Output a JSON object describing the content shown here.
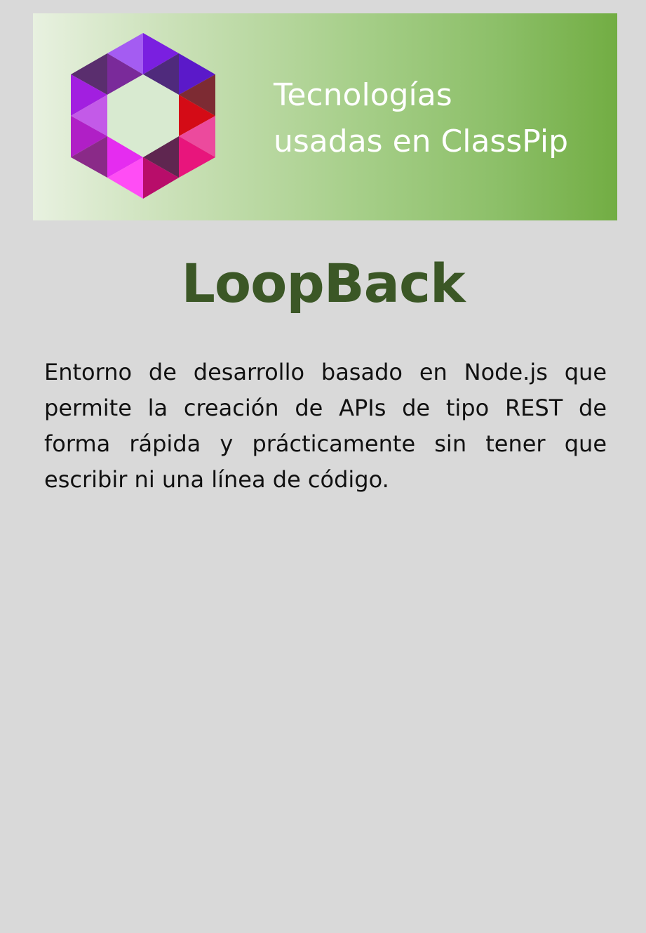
{
  "banner": {
    "title_line1": "Tecnologías",
    "title_line2": "usadas en ClassPip",
    "logo": "hexagon-logo-icon"
  },
  "main": {
    "title": "LoopBack",
    "description": "Entorno de desarrollo basado en Node.js que permite la creación de APIs de tipo REST de forma rápida y prácticamente sin tener que escribir ni una línea de código."
  },
  "colors": {
    "background": "#d9d9d9",
    "banner_start": "#e8f1e0",
    "banner_end": "#72ad43",
    "title": "#3b5726",
    "text": "#111111"
  }
}
